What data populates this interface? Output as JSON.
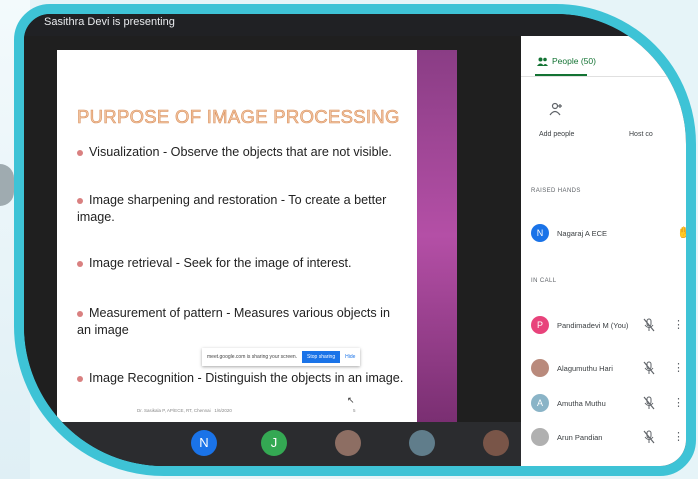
{
  "presenter_text": "Sasithra Devi is presenting",
  "slide": {
    "title": "PURPOSE OF IMAGE PROCESSING",
    "bullets": [
      "Visualization - Observe the objects that are not visible.",
      "Image sharpening and restoration - To create a better image.",
      "Image retrieval - Seek for the image of interest.",
      "Measurement of pattern - Measures various objects in an image",
      "Image Recognition - Distinguish the objects in an image."
    ],
    "footer": "Dr. Sasikala P, AP/ECE, RT, Chennai",
    "footer_date": "1/6/2020",
    "page": "5"
  },
  "share_notice": {
    "text": "meet.google.com is sharing your screen.",
    "stop_label": "Stop sharing",
    "hide_label": "Hide"
  },
  "bottom_tiles": [
    {
      "initial": "N",
      "color": "#1a73e8"
    },
    {
      "initial": "J",
      "color": "#34a853"
    },
    {
      "initial": "",
      "color": "#8d6e63"
    },
    {
      "initial": "",
      "color": "#607d8b"
    },
    {
      "initial": "",
      "color": "#795548"
    }
  ],
  "panel": {
    "people_tab": "People (50)",
    "add_people": "Add people",
    "host_controls": "Host co",
    "raised_hands_label": "RAISED HANDS",
    "in_call_label": "IN CALL",
    "raised": [
      {
        "initial": "N",
        "name": "Nagaraj A ECE",
        "color": "#1a73e8"
      }
    ],
    "in_call": [
      {
        "initial": "P",
        "name": "Pandimadevi M (You)",
        "color": "#e8437b"
      },
      {
        "initial": "",
        "name": "Alagumuthu Hari",
        "color": "#b98a7c"
      },
      {
        "initial": "A",
        "name": "Amutha Muthu",
        "color": "#8ab4c7"
      },
      {
        "initial": "",
        "name": "Arun Pandian",
        "color": "#b0b0b0"
      }
    ]
  },
  "colors": {
    "frame": "#3ec3d6",
    "accent_green": "#137333",
    "stop_button": "#1a73e8"
  }
}
